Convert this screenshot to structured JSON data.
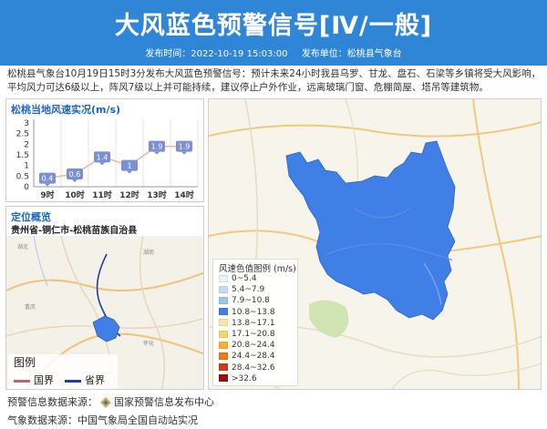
{
  "header": {
    "title": "大风蓝色预警信号[Ⅳ/一般]",
    "publish_time_label": "发布时间：2022-10-19 15:03:00",
    "publisher_label": "发布单位：松桃县气象台",
    "bg_color": "#2f86d6"
  },
  "summary": "松桃县气象台10月19日15时3分发布大风蓝色预警信号：预计未来24小时我县乌罗、甘龙、盘石、石梁等乡镇将受大风影响，平均风力可达6级以上，阵风7级以上并可能持续，建议停止户外作业，远离玻璃门窗、危棚简屋、塔吊等建筑物。",
  "wind_chart": {
    "title": "松桃当地风速实况(m/s)",
    "chart_data": {
      "type": "line",
      "title": "松桃当地风速实况(m/s)",
      "categories": [
        "9时",
        "10时",
        "11时",
        "12时",
        "13时",
        "14时"
      ],
      "values": [
        0.4,
        0.6,
        1.4,
        1.0,
        1.9,
        1.9
      ],
      "data_labels": [
        "0.4",
        "0.6",
        "1.4",
        "1",
        "1.9",
        "1.9"
      ],
      "y_ticks": [
        "0",
        "0.5",
        "1",
        "1.5",
        "2",
        "2.5",
        "3"
      ],
      "ylim": [
        0,
        3
      ],
      "grid": false,
      "line_color": "#e8b7a4",
      "label_color": "#7b8fd4"
    }
  },
  "location": {
    "title": "定位概览",
    "name": "贵州省-铜仁市-松桃苗族自治县",
    "legend_title": "图例",
    "legend_items": [
      {
        "label": "国界",
        "color": "#c0607a"
      },
      {
        "label": "省界",
        "color": "#1c3fa8"
      }
    ]
  },
  "map": {
    "warning_fill": "#3f7fe6",
    "legend_title": "风速色值图例 (m/s)",
    "legend": [
      {
        "label": "0~5.4",
        "color": "#e8f2fa"
      },
      {
        "label": "5.4~7.9",
        "color": "#c4def3"
      },
      {
        "label": "7.9~10.8",
        "color": "#9cc7ea"
      },
      {
        "label": "10.8~13.8",
        "color": "#3f7fe6"
      },
      {
        "label": "13.8~17.1",
        "color": "#fbe4a6"
      },
      {
        "label": "17.1~20.8",
        "color": "#fbd56a"
      },
      {
        "label": "20.8~24.4",
        "color": "#f7b12f"
      },
      {
        "label": "24.4~28.4",
        "color": "#ef7b14"
      },
      {
        "label": "28.4~32.6",
        "color": "#d23a1e"
      },
      {
        "label": ">32.6",
        "color": "#9c1010"
      }
    ]
  },
  "footer": {
    "source_label": "预警信息数据来源：",
    "source_name": "国家预警信息发布中心",
    "weather_source": "气象数据来源：中国气象局全国自动站实况"
  }
}
